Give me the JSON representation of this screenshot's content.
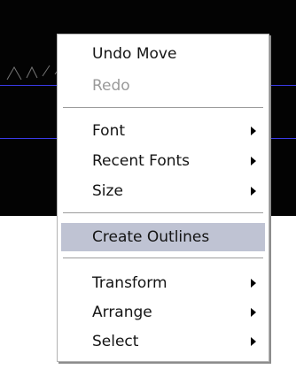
{
  "context_menu": {
    "items": [
      {
        "label": "Undo Move",
        "enabled": true,
        "submenu": false
      },
      {
        "label": "Redo",
        "enabled": false,
        "submenu": false
      },
      {
        "label": "Font",
        "enabled": true,
        "submenu": true
      },
      {
        "label": "Recent Fonts",
        "enabled": true,
        "submenu": true
      },
      {
        "label": "Size",
        "enabled": true,
        "submenu": true
      },
      {
        "label": "Create Outlines",
        "enabled": true,
        "submenu": false,
        "highlighted": true
      },
      {
        "label": "Transform",
        "enabled": true,
        "submenu": true
      },
      {
        "label": "Arrange",
        "enabled": true,
        "submenu": true
      },
      {
        "label": "Select",
        "enabled": true,
        "submenu": true
      }
    ]
  },
  "colors": {
    "canvas_background": "#030303",
    "guide_line": "#3a3ae6",
    "menu_background": "#ffffff",
    "highlight": "#bfc3d3",
    "disabled_text": "#9a9a9a"
  }
}
